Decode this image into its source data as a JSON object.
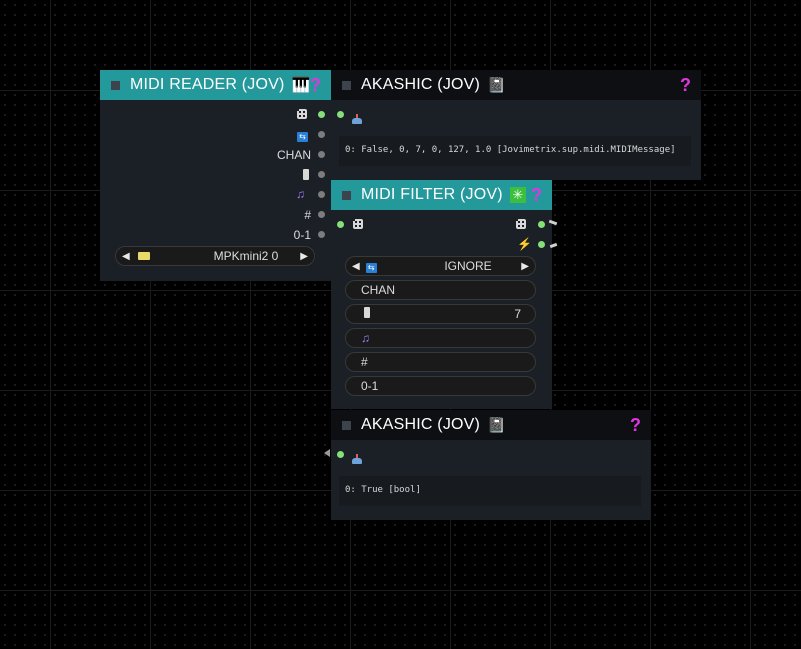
{
  "nodes": {
    "midi_reader": {
      "title": "MIDI READER (JOV)",
      "title_icon": "🎹",
      "help": "?",
      "outputs": [
        "",
        "",
        "CHAN",
        "",
        "",
        "#",
        "0-1"
      ],
      "device": {
        "value": "MPKmini2 0",
        "left_arrow": "◀",
        "right_arrow": "▶"
      }
    },
    "akashic_top": {
      "title": "AKASHIC (JOV)",
      "title_icon": "📓",
      "help": "?",
      "output_text": "0: False, 0, 7, 0, 127, 1.0 [Jovimetrix.sup.midi.MIDIMessage]"
    },
    "midi_filter": {
      "title": "MIDI FILTER (JOV)",
      "title_icon": "✳",
      "help": "?",
      "mode": {
        "value": "IGNORE",
        "left_arrow": "◀",
        "right_arrow": "▶"
      },
      "chan_label": "CHAN",
      "control_value": "7",
      "num_label": "#",
      "norm_label": "0-1"
    },
    "akashic_bottom": {
      "title": "AKASHIC (JOV)",
      "title_icon": "📓",
      "help": "?",
      "output_text": "0: True [bool]"
    }
  },
  "colors": {
    "teal_header": "#23999b",
    "dark_header": "#0d0f12",
    "node_body": "#1b1f26",
    "link_dot_on": "#86e07a",
    "help_magenta": "#e036e0"
  },
  "icons": {
    "grid": "grid-icon",
    "swap": "swap-icon",
    "slider": "slider-icon",
    "music": "music-note-icon",
    "bolt": "bolt-icon",
    "keyboard": "keyboard-icon",
    "pipe": "pipe-icon"
  }
}
